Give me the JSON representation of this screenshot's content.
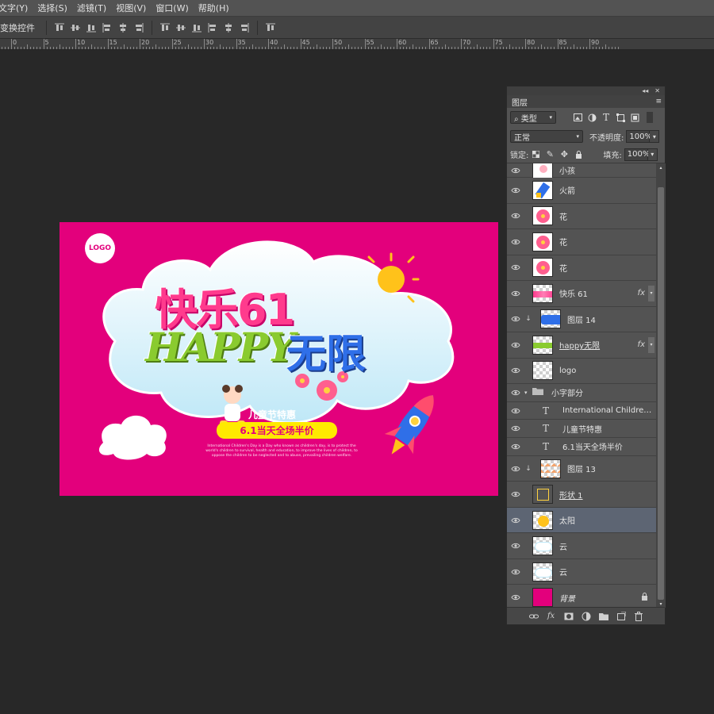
{
  "menu": [
    "文字(Y)",
    "选择(S)",
    "滤镜(T)",
    "视图(V)",
    "窗口(W)",
    "帮助(H)"
  ],
  "options_bar": {
    "label": "变换控件",
    "align_icons": [
      "align-top-icon",
      "align-vcenter-icon",
      "align-bottom-icon",
      "align-left-icon",
      "align-hcenter-icon",
      "align-right-icon",
      "distribute-top-icon",
      "distribute-vcenter-icon",
      "distribute-bottom-icon",
      "distribute-left-icon",
      "distribute-hcenter-icon",
      "distribute-right-icon",
      "auto-align-icon"
    ]
  },
  "ruler_labels": [
    "5",
    "0",
    "5",
    "10",
    "15",
    "20",
    "25",
    "30",
    "35",
    "40",
    "45",
    "50",
    "55",
    "60",
    "65",
    "70",
    "75",
    "80",
    "85",
    "90"
  ],
  "artwork": {
    "logo": "LOGO",
    "title_cn": "快乐61",
    "title_happy": "HAPPY",
    "title_wx": "无限",
    "subtitle": "儿童节特惠",
    "promo": "6.1当天全场半价",
    "tiny_text": "International Children's Day is a Day who known as children's day, is to protect the world's children to survival, health and education, to improve the lives of children, to oppose the children to be neglected and to abuse, prevailing children welfare.",
    "bg_color": "#e3007c"
  },
  "layers_panel": {
    "tab": "图层",
    "filter_kind": "类型",
    "filter_icons": [
      "image-filter-icon",
      "adjust-filter-icon",
      "text-filter-icon",
      "shape-filter-icon",
      "smart-object-filter-icon"
    ],
    "blend_mode": "正常",
    "opacity_label": "不透明度:",
    "opacity": "100%",
    "lock_label": "锁定:",
    "fill_label": "填充:",
    "fill": "100%",
    "layers": [
      {
        "name": "小孩",
        "thumb": "kid"
      },
      {
        "name": "火箭",
        "thumb": "rocket"
      },
      {
        "name": "花",
        "thumb": "flower"
      },
      {
        "name": "花",
        "thumb": "flower"
      },
      {
        "name": "花",
        "thumb": "flower"
      },
      {
        "name": "快乐 61",
        "thumb": "text-art",
        "fx": "fx"
      },
      {
        "name": "图层 14",
        "thumb": "blue",
        "clipped": true
      },
      {
        "name": "happy无限",
        "thumb": "green",
        "fx": "fx",
        "underline": true
      },
      {
        "name": "logo",
        "thumb": "empty"
      },
      {
        "name": "小字部分",
        "group": true
      },
      {
        "name": "International Children'...",
        "type": "text"
      },
      {
        "name": "儿童节特惠",
        "type": "text"
      },
      {
        "name": "6.1当天全场半价",
        "type": "text"
      },
      {
        "name": "图层 13",
        "thumb": "orange",
        "clipped": true
      },
      {
        "name": "形状 1",
        "thumb": "shape",
        "underline": true
      },
      {
        "name": "太阳",
        "thumb": "sun",
        "selected": true
      },
      {
        "name": "云",
        "thumb": "cloud"
      },
      {
        "name": "云",
        "thumb": "cloud"
      },
      {
        "name": "背景",
        "thumb": "pink",
        "italic": true,
        "locked": true
      }
    ],
    "footer_icons": [
      "link-layers-icon",
      "fx-icon",
      "mask-icon",
      "adjustment-icon",
      "new-group-icon",
      "new-layer-icon",
      "trash-icon"
    ]
  }
}
